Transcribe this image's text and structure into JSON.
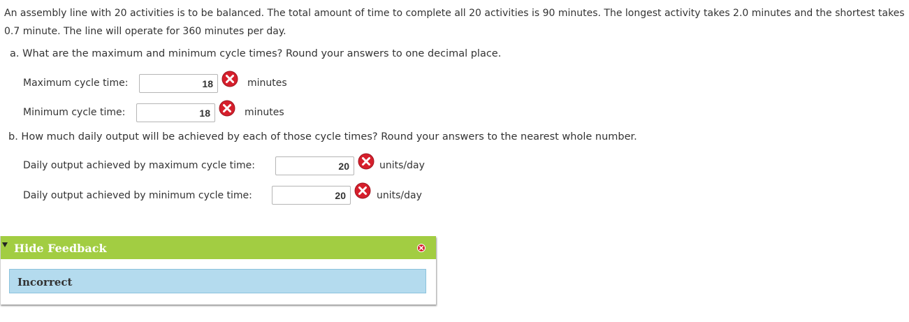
{
  "problem": {
    "text": "An assembly line with 20 activities is to be balanced. The total amount of time to complete all 20 activities is 90 minutes. The longest activity takes 2.0 minutes and the shortest takes 0.7 minute. The line will operate for 360 minutes per day."
  },
  "part_a": {
    "question": "a. What are the maximum and minimum cycle times? Round your answers to one decimal place.",
    "fields": [
      {
        "label": "Maximum cycle time:",
        "value": "18",
        "unit": "minutes",
        "status": "incorrect"
      },
      {
        "label": "Minimum cycle time:",
        "value": "18",
        "unit": "minutes",
        "status": "incorrect"
      }
    ]
  },
  "part_b": {
    "question": "b. How much daily output will be achieved by each of those cycle times? Round your answers to the nearest whole number.",
    "fields": [
      {
        "label": "Daily output achieved by maximum cycle time:",
        "value": "20",
        "unit": "units/day",
        "status": "incorrect"
      },
      {
        "label": "Daily output achieved by minimum cycle time:",
        "value": "20",
        "unit": "units/day",
        "status": "incorrect"
      }
    ]
  },
  "feedback": {
    "toggle_label": "Hide Feedback",
    "message": "Incorrect"
  },
  "colors": {
    "feedback_header": "#a2cd42",
    "feedback_body": "#b4dbee",
    "incorrect_icon": "#d61f2c"
  },
  "icons": {
    "incorrect": "x-circle-icon",
    "caret": "caret-down-icon",
    "close": "close-icon"
  }
}
